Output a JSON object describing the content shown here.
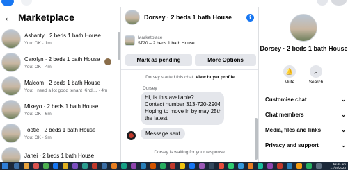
{
  "marketplace": {
    "title": "Marketplace",
    "chats": [
      {
        "name": "Ashanty · 2 beds 1 bath House",
        "sub": "You: OK · 1m"
      },
      {
        "name": "Carolyn · 2 beds 1 bath House",
        "sub": "You: OK · 4m"
      },
      {
        "name": "Malcom · 2 beds 1 bath House",
        "sub": "You: I need a lot good tenant Kindl... · 4m"
      },
      {
        "name": "Mikeyo · 2 beds 1 bath House",
        "sub": "You: OK · 6m"
      },
      {
        "name": "Tootie · 2 beds 1 bath House",
        "sub": "You: OK · 9m"
      },
      {
        "name": "Janei · 2 beds 1 bath House",
        "sub": ""
      }
    ]
  },
  "conversation": {
    "title": "Dorsey · 2 beds 1 bath House",
    "listing_label": "Marketplace",
    "listing_price": "$720 – 2 beds 1 bath House",
    "mark_pending": "Mark as pending",
    "more_options": "More Options",
    "started_prefix": "Dorsey started this chat.",
    "view_profile": "View buyer profile",
    "sender": "Dorsey",
    "message_lines": [
      "Hi, is this available?",
      "Contact number 313-720-2904",
      "Hoping to move in by may 25th",
      "the latest"
    ],
    "sent_message": "Message sent",
    "waiting": "Dorsey is waiting for your response."
  },
  "details": {
    "name": "Dorsey · 2 beds 1 bath House",
    "mute": "Mute",
    "search": "Search",
    "sections": [
      "Customise chat",
      "Chat members",
      "Media, files and links",
      "Privacy and support"
    ]
  },
  "taskbar": {
    "time": "11:41 am",
    "date": "17/04/2023"
  },
  "colors": {
    "accent": "#1877f2",
    "button_bg": "#e4e6eb",
    "secondary_text": "#65676b",
    "taskbar": "#1b2838"
  },
  "icons": [
    "facebook-logo-icon",
    "search-icon",
    "back-arrow-icon",
    "info-icon",
    "mute-bell-icon",
    "search-icon",
    "chevron-down-icon"
  ]
}
